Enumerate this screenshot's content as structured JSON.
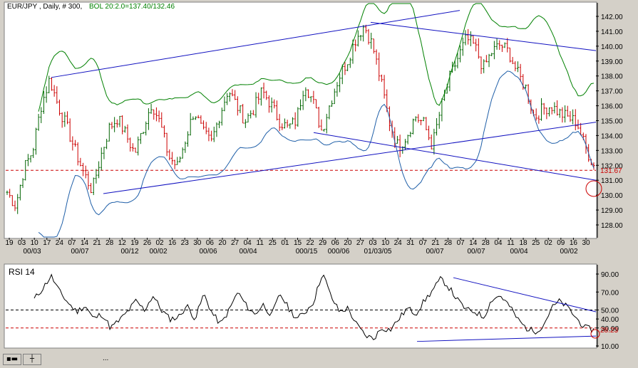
{
  "header": {
    "symbol": "EUR/JPY , Daily, # 300,",
    "indicator": "BOL 20:2.0=137.40/132.46"
  },
  "lower_panel": {
    "title": "RSI 14"
  },
  "colors": {
    "background": "#d4d0c8",
    "panel": "#ffffff",
    "bars_up": "#006400",
    "bars_down": "#cc0000",
    "bollinger_upper": "#008000",
    "bollinger_lower": "#1f5fa8",
    "trendline": "#1010c0",
    "reference": "#cc0000"
  },
  "icons": [
    "window-icon",
    "crosshair-icon"
  ],
  "statusbar": {
    "dots": "..."
  },
  "chart_data": [
    {
      "type": "bar",
      "subtype": "ohlc",
      "title": "EUR/JPY , Daily, # 300,",
      "y_axis_side": "right",
      "ylim": [
        127.5,
        142.5
      ],
      "yticks": [
        "142.00",
        "141.00",
        "140.00",
        "139.00",
        "138.00",
        "137.00",
        "136.00",
        "135.00",
        "134.00",
        "133.00",
        "132.00",
        "131.00",
        "130.00",
        "129.00",
        "128.00"
      ],
      "reference_line": {
        "value": 131.67,
        "label": "131.67",
        "style": "dashed",
        "color": "#cc0000"
      },
      "x_tick_labels": [
        "19",
        "03",
        "10",
        "17",
        "24",
        "07",
        "14",
        "21",
        "28",
        "12",
        "19",
        "26",
        "02",
        "16",
        "23",
        "30",
        "06",
        "20",
        "27",
        "04",
        "11",
        "25",
        "01",
        "15",
        "22",
        "29",
        "06",
        "20",
        "27",
        "03",
        "10",
        "24",
        "31",
        "07",
        "21",
        "28",
        "07",
        "14",
        "28",
        "04",
        "11",
        "18",
        "25",
        "02",
        "09",
        "16",
        "30"
      ],
      "x_period_labels": [
        "00/03",
        "00/07",
        "00/12",
        "00/02",
        "00/06",
        "00/04",
        "000/15",
        "000/06",
        "01/03/05",
        "00/07",
        "00/07",
        "00/04",
        "00/02"
      ],
      "close_path": [
        130.2,
        129.3,
        131.8,
        133.0,
        136.0,
        137.8,
        136.0,
        134.6,
        133.0,
        131.5,
        130.3,
        132.6,
        134.5,
        135.2,
        134.0,
        132.8,
        134.5,
        136.2,
        134.8,
        132.6,
        131.9,
        133.8,
        135.7,
        134.2,
        133.5,
        135.4,
        137.1,
        136.0,
        135.0,
        135.8,
        137.0,
        136.1,
        135.0,
        134.5,
        135.0,
        137.6,
        136.2,
        134.3,
        136.2,
        137.9,
        139.0,
        140.5,
        141.4,
        140.0,
        137.5,
        134.8,
        133.2,
        134.0,
        135.3,
        134.8,
        133.3,
        135.8,
        137.8,
        139.2,
        140.5,
        140.0,
        138.5,
        139.6,
        140.1,
        139.6,
        138.2,
        137.2,
        135.2,
        135.8,
        136.0,
        135.5,
        135.2,
        134.9,
        133.2,
        132.0
      ],
      "trendlines": [
        {
          "from": [
            "17",
            "137.9"
          ],
          "to": [
            "right-edge",
            "142.4"
          ]
        },
        {
          "from": [
            "21",
            "130.1"
          ],
          "to": [
            "30",
            "134.9"
          ]
        },
        {
          "from": [
            "27",
            "141.6"
          ],
          "to": [
            "right-edge",
            "139.7"
          ]
        },
        {
          "from": [
            "15",
            "134.2"
          ],
          "to": [
            "right-edge",
            "131.0"
          ]
        }
      ],
      "series": [
        {
          "name": "BOL 20:2.0 upper",
          "value_last": 137.4
        },
        {
          "name": "BOL 20:2.0 lower",
          "value_last": 132.46
        }
      ]
    },
    {
      "type": "line",
      "title": "RSI 14",
      "y_axis_side": "right",
      "ylim": [
        5,
        95
      ],
      "yticks": [
        "90.00",
        "70.00",
        "50.00",
        "40.00",
        "30.00",
        "10.00"
      ],
      "reference_lines": [
        {
          "value": 50,
          "style": "dashed",
          "color": "#000000"
        },
        {
          "value": 30,
          "style": "dashed",
          "color": "#cc0000"
        }
      ],
      "current_value": {
        "value": 28.23,
        "label": "28.23"
      },
      "series": [
        {
          "values": [
            62,
            74,
            88,
            70,
            58,
            48,
            55,
            40,
            46,
            30,
            38,
            48,
            60,
            50,
            66,
            50,
            40,
            42,
            55,
            40,
            68,
            46,
            34,
            50,
            70,
            55,
            45,
            56,
            44,
            68,
            52,
            40,
            48,
            60,
            92,
            65,
            48,
            52,
            34,
            22,
            18,
            30,
            28,
            40,
            52,
            46,
            60,
            72,
            85,
            74,
            60,
            50,
            48,
            42,
            62,
            66,
            55,
            40,
            30,
            26,
            32,
            52,
            60,
            52,
            40,
            30,
            28
          ]
        }
      ],
      "trendlines": [
        {
          "from_value": 86,
          "to_value": 48
        },
        {
          "from_value": 15,
          "to_value": 21
        }
      ]
    }
  ]
}
